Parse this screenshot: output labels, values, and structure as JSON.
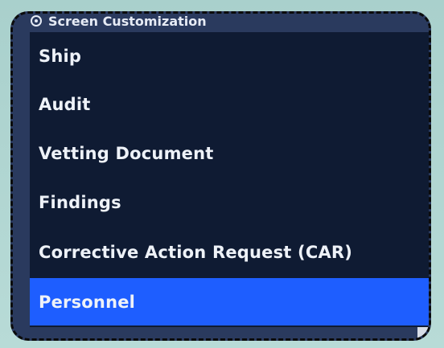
{
  "header": {
    "title": "Screen Customization",
    "icon": "radio-button-icon"
  },
  "menu": {
    "items": [
      {
        "label": "Ship",
        "selected": false
      },
      {
        "label": "Audit",
        "selected": false
      },
      {
        "label": "Vetting Document",
        "selected": false
      },
      {
        "label": "Findings",
        "selected": false
      },
      {
        "label": "Corrective Action Request (CAR)",
        "selected": false
      },
      {
        "label": "Personnel",
        "selected": true
      }
    ]
  },
  "colors": {
    "panel": "#2a3a5e",
    "menu_background": "#0f1b33",
    "selected": "#1e5eff",
    "text": "#eef2f8"
  }
}
